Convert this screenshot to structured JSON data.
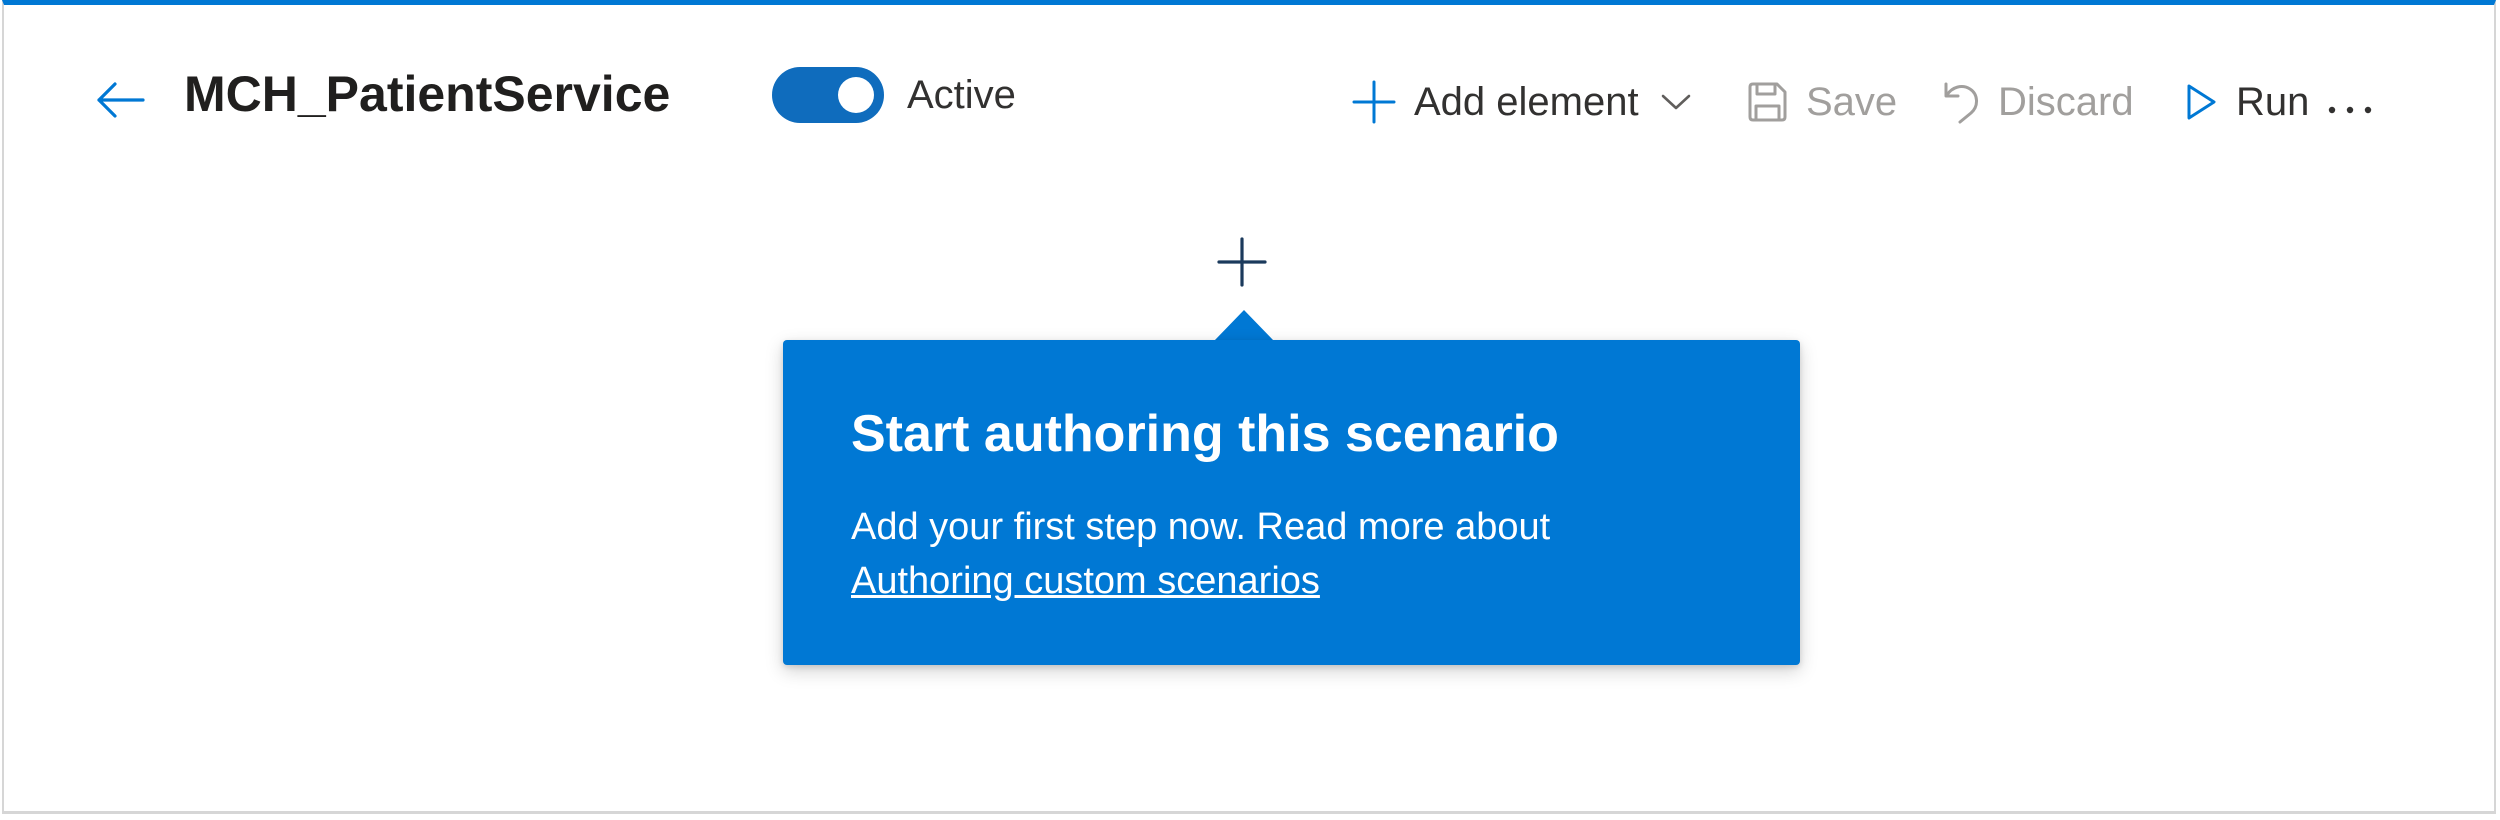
{
  "header": {
    "title": "MCH_PatientService",
    "back_icon": "arrow-left-icon",
    "toggle": {
      "state": "on",
      "label": "Active",
      "color": "#0f6cbd"
    }
  },
  "commands": {
    "add_element": {
      "label": "Add element",
      "icon": "plus-icon",
      "menu_icon": "chevron-down-icon",
      "enabled": true
    },
    "save": {
      "label": "Save",
      "icon": "save-icon",
      "enabled": false
    },
    "discard": {
      "label": "Discard",
      "icon": "undo-icon",
      "enabled": false
    },
    "run": {
      "label": "Run",
      "icon": "play-icon",
      "enabled": true
    },
    "more": {
      "icon": "more-icon"
    }
  },
  "canvas": {
    "add_step_icon": "plus-icon",
    "callout": {
      "title": "Start authoring this scenario",
      "body": "Add your first step now. Read more about",
      "link": "Authoring custom scenarios",
      "color": "#0078d4"
    }
  },
  "colors": {
    "accent": "#0078d4",
    "disabled": "#a19f9d",
    "text": "#323130"
  }
}
